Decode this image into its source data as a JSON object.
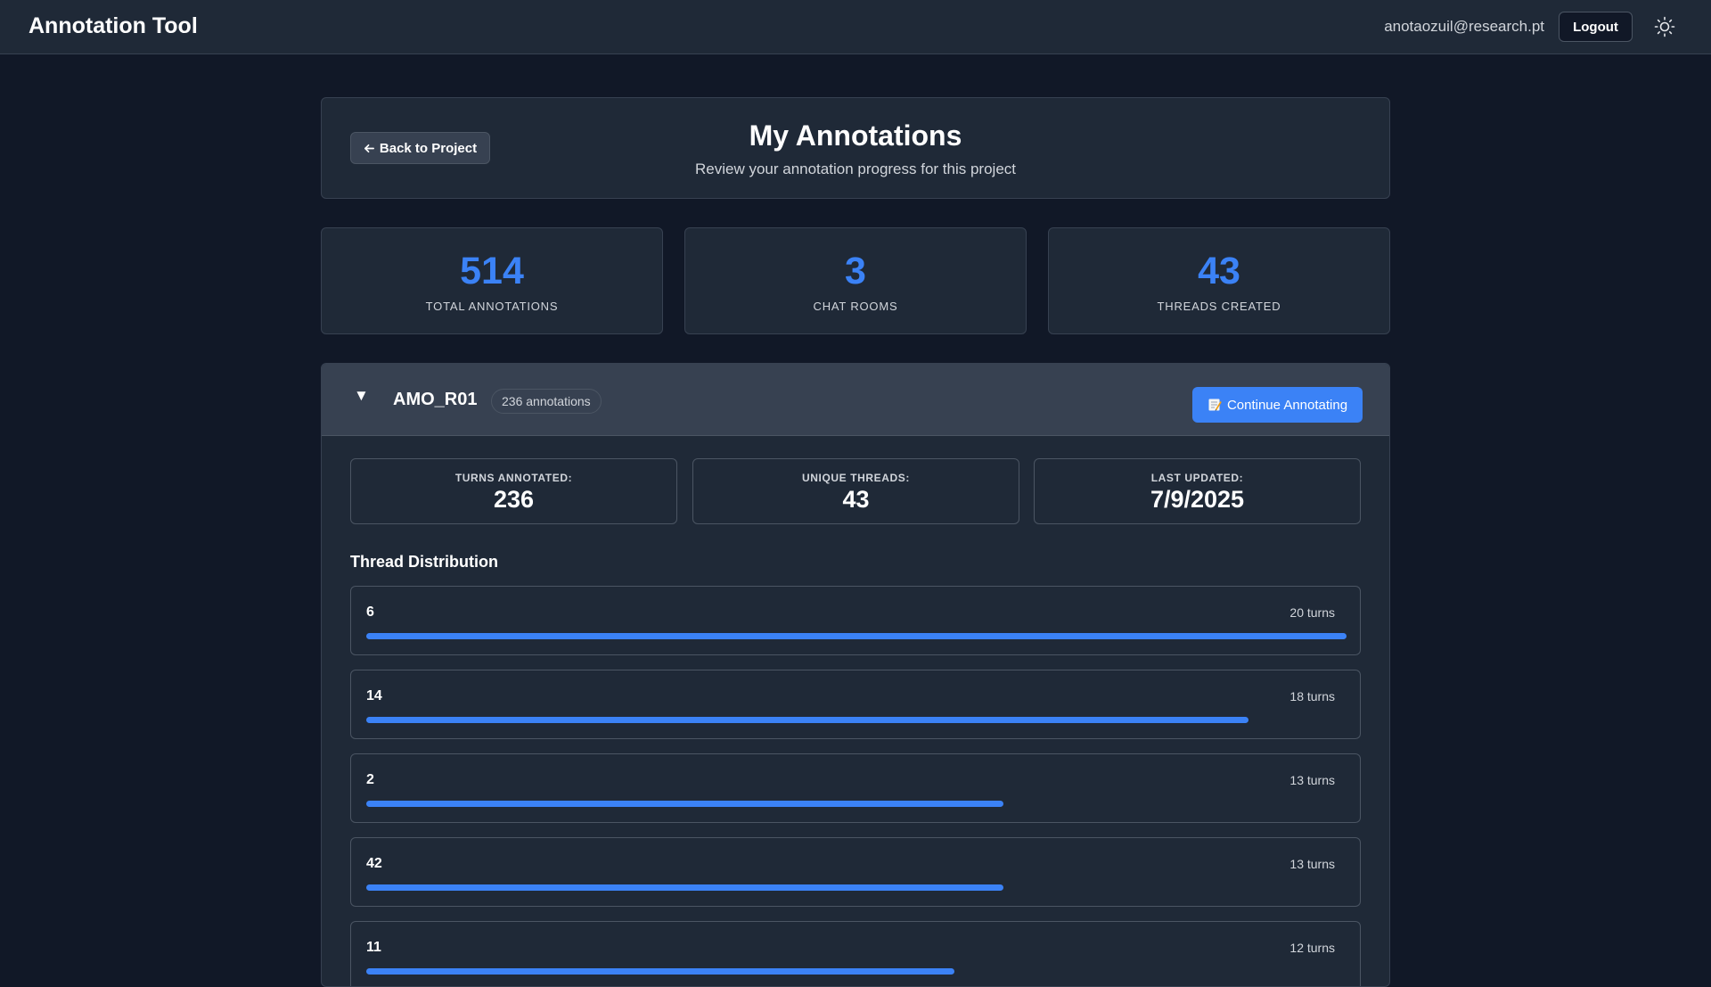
{
  "app": {
    "title": "Annotation Tool",
    "user_email": "anotaozuil@research.pt",
    "logout_label": "Logout",
    "theme_icon": "sun-icon"
  },
  "header": {
    "back_label": "Back to Project",
    "back_icon": "arrow-left-icon",
    "title": "My Annotations",
    "subtitle": "Review your annotation progress for this project"
  },
  "stats": [
    {
      "value": "514",
      "label": "TOTAL ANNOTATIONS"
    },
    {
      "value": "3",
      "label": "CHAT ROOMS"
    },
    {
      "value": "43",
      "label": "THREADS CREATED"
    }
  ],
  "room": {
    "toggle": "▼",
    "name": "AMO_R01",
    "badge": "236 annotations",
    "continue_label": "Continue Annotating",
    "continue_icon": "memo-icon",
    "metrics": [
      {
        "label": "TURNS ANNOTATED:",
        "value": "236"
      },
      {
        "label": "UNIQUE THREADS:",
        "value": "43"
      },
      {
        "label": "LAST UPDATED:",
        "value": "7/9/2025"
      }
    ],
    "distribution_title": "Thread Distribution",
    "threads": [
      {
        "id": "6",
        "turns_label": "20 turns",
        "fraction": 1.0
      },
      {
        "id": "14",
        "turns_label": "18 turns",
        "fraction": 0.9
      },
      {
        "id": "2",
        "turns_label": "13 turns",
        "fraction": 0.65
      },
      {
        "id": "42",
        "turns_label": "13 turns",
        "fraction": 0.65
      },
      {
        "id": "11",
        "turns_label": "12 turns",
        "fraction": 0.6
      }
    ]
  },
  "colors": {
    "accent": "#3b82f6",
    "background": "#111827",
    "surface": "#1f2937"
  }
}
